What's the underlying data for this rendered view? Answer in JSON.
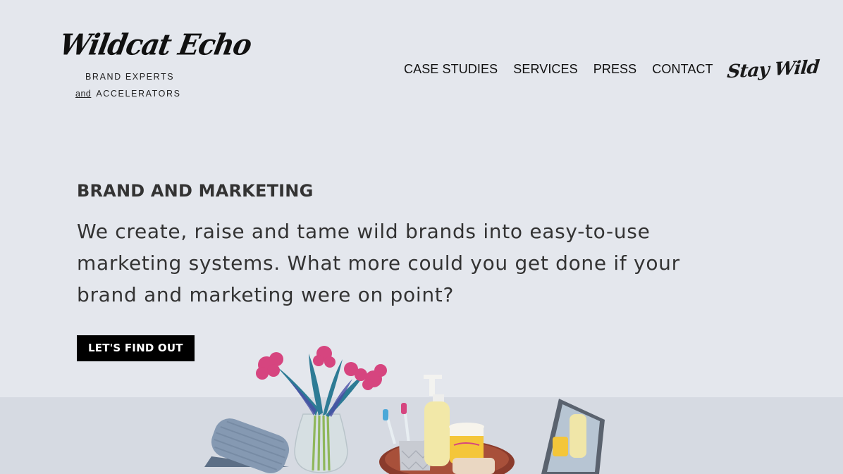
{
  "brand": {
    "logo_script": "Wildcat Echo",
    "tagline_line1": "BRAND EXPERTS",
    "tagline_and": "and",
    "tagline_line2": "ACCELERATORS"
  },
  "nav": {
    "items": [
      {
        "label": "CASE STUDIES"
      },
      {
        "label": "SERVICES"
      },
      {
        "label": "PRESS"
      },
      {
        "label": "CONTACT"
      }
    ],
    "stay_wild": "Stay Wild"
  },
  "hero": {
    "eyebrow": "BRAND AND MARKETING",
    "headline": "We create, raise and tame wild brands into easy-to-use marketing systems. What more could you get done if your brand and marketing were on point?",
    "cta_label": "LET'S FIND OUT"
  },
  "colors": {
    "background": "#e4e7ed",
    "table": "#d6dae2",
    "text": "#333333",
    "cta_bg": "#000000",
    "cta_text": "#ffffff",
    "flower": "#d6457f",
    "stem": "#2b6c8a"
  },
  "illustration": {
    "items": [
      "towel",
      "flower-vase",
      "toothbrush-cup",
      "soap-bottle",
      "cream-jar",
      "soap-bar",
      "wooden-tray",
      "mirror"
    ]
  }
}
